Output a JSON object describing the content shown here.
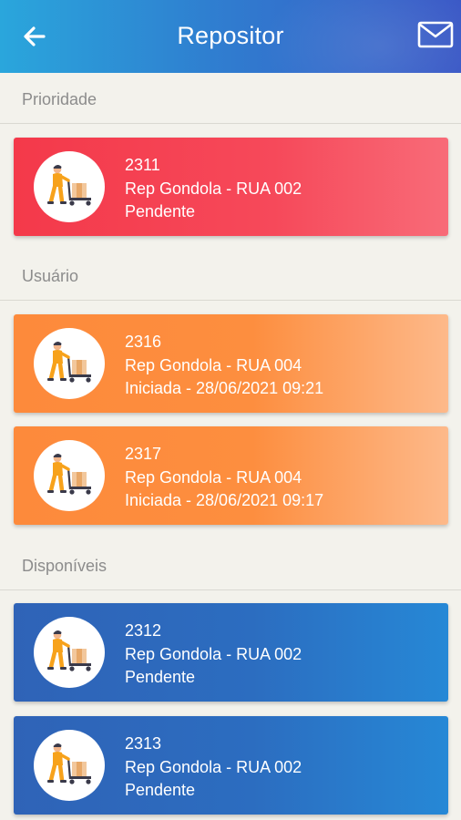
{
  "header": {
    "title": "Repositor",
    "back_icon": "arrow-left-icon",
    "mail_icon": "envelope-icon"
  },
  "sections": [
    {
      "label": "Prioridade",
      "color": "#f4394a"
    },
    {
      "label": "Usuário",
      "color": "#fd8a3b"
    },
    {
      "label": "Disponíveis",
      "color": "#2f63b7"
    }
  ],
  "tasks": [
    {
      "id": "2311",
      "description": "Rep Gondola - RUA 002",
      "status": "Pendente",
      "section": "Prioridade"
    },
    {
      "id": "2316",
      "description": "Rep Gondola - RUA 004",
      "status": "Iniciada - 28/06/2021 09:21",
      "section": "Usuário"
    },
    {
      "id": "2317",
      "description": "Rep Gondola - RUA 004",
      "status": "Iniciada - 28/06/2021 09:17",
      "section": "Usuário"
    },
    {
      "id": "2312",
      "description": "Rep Gondola - RUA 002",
      "status": "Pendente",
      "section": "Disponíveis"
    },
    {
      "id": "2313",
      "description": "Rep Gondola - RUA 002",
      "status": "Pendente",
      "section": "Disponíveis"
    }
  ],
  "task_icon": "worker-pushing-cart-icon"
}
